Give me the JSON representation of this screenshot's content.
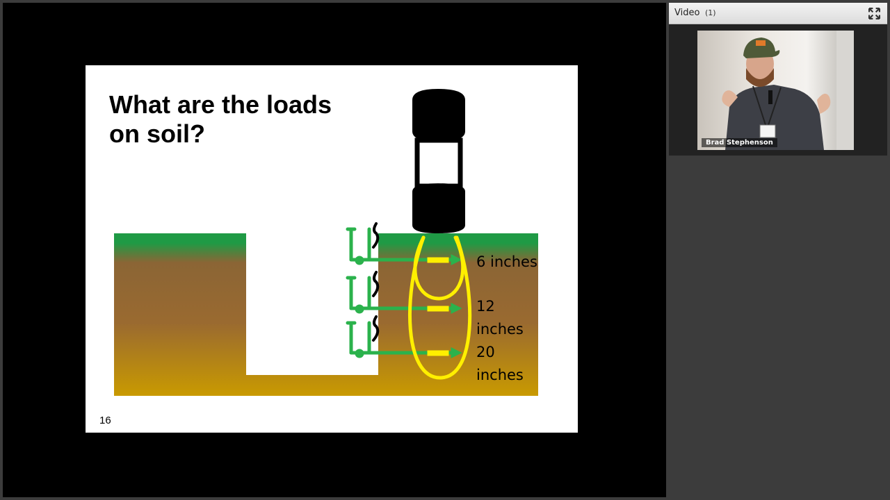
{
  "slide": {
    "title": "What are the loads\non soil?",
    "page_number": "16",
    "depth_labels": [
      "6 inches",
      "12\ninches",
      "20\ninches"
    ]
  },
  "video_panel": {
    "title": "Video",
    "count": "(1)",
    "speaker_name": "Brad Stephenson",
    "fullscreen_icon": "expand-arrows-icon"
  },
  "colors": {
    "stage": "#000000",
    "soil_top": "#1f9a45",
    "soil_mid": "#9a6a36",
    "soil_bottom": "#c99a00",
    "probe": "#2bb24c",
    "highlight": "#ffef00",
    "tire": "#000000"
  }
}
